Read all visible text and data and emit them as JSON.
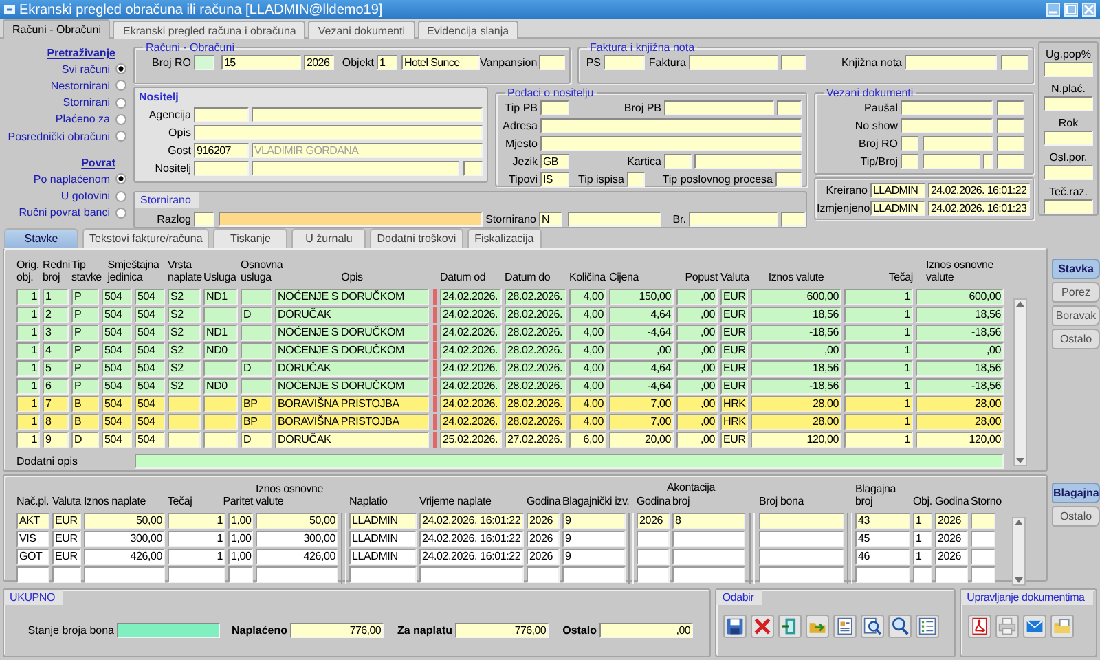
{
  "window": {
    "title": "Ekranski pregled obračuna ili računa [LLADMIN@lldemo19]"
  },
  "top_tabs": [
    {
      "label": "Računi - Obračuni",
      "selected": true
    },
    {
      "label": "Ekranski pregled računa i obračuna",
      "selected": false
    },
    {
      "label": "Vezani dokumenti",
      "selected": false
    },
    {
      "label": "Evidencija slanja",
      "selected": false
    }
  ],
  "search": {
    "heading": "Pretraživanje",
    "options": [
      {
        "label": "Svi računi",
        "selected": true
      },
      {
        "label": "Nestornirani",
        "selected": false
      },
      {
        "label": "Stornirani",
        "selected": false
      },
      {
        "label": "Plaćeno za",
        "selected": false
      },
      {
        "label": "Posrednički obračuni",
        "selected": false
      }
    ]
  },
  "refund": {
    "heading": "Povrat",
    "options": [
      {
        "label": "Po naplaćenom",
        "selected": true
      },
      {
        "label": "U gotovini",
        "selected": false
      },
      {
        "label": "Ručni povrat banci",
        "selected": false
      }
    ]
  },
  "invoice": {
    "title": "Računi - Obračuni",
    "broj_ro": {
      "label": "Broj RO",
      "number": "15",
      "year": "2026"
    },
    "objekt": {
      "label": "Objekt",
      "code": "1",
      "name": "Hotel Sunce"
    },
    "vanpansion": {
      "label": "Vanpansion"
    }
  },
  "invoice_notes": {
    "title": "Faktura i knjižna nota",
    "ps": {
      "label": "PS"
    },
    "faktura": {
      "label": "Faktura"
    },
    "knjizna_nota": {
      "label": "Knjižna nota"
    }
  },
  "holder": {
    "title": "Nositelj",
    "agencija": {
      "label": "Agencija"
    },
    "opis": {
      "label": "Opis"
    },
    "gost": {
      "label": "Gost",
      "code": "916207",
      "name": "VLADIMIR GORDANA",
      "name_disabled": true
    },
    "nositelj": {
      "label": "Nositelj"
    }
  },
  "holder_info": {
    "title": "Podaci o nositelju",
    "tip_pb": {
      "label": "Tip PB"
    },
    "broj_pb": {
      "label": "Broj PB"
    },
    "adresa": {
      "label": "Adresa"
    },
    "mjesto": {
      "label": "Mjesto"
    },
    "jezik": {
      "label": "Jezik",
      "code": "GB"
    },
    "kartica": {
      "label": "Kartica"
    },
    "tipovi": {
      "label": "Tipovi",
      "code": "IS"
    },
    "tip_ispisa": {
      "label": "Tip ispisa"
    },
    "tip_procesa": {
      "label": "Tip poslovnog procesa"
    }
  },
  "linked_docs": {
    "title": "Vezani dokumenti",
    "pausal": {
      "label": "Paušal"
    },
    "no_show": {
      "label": "No show"
    },
    "broj_ro": {
      "label": "Broj RO"
    },
    "tip_broj": {
      "label": "Tip/Broj"
    }
  },
  "audit": {
    "created": {
      "label": "Kreirano",
      "user": "LLADMIN",
      "time": "24.02.2026. 16:01:22"
    },
    "modified": {
      "label": "Izmjenjeno",
      "user": "LLADMIN",
      "time": "24.02.2026. 16:01:23"
    }
  },
  "storno": {
    "title": "Stornirano",
    "razlog": {
      "label": "Razlog"
    },
    "stornirano": {
      "label": "Stornirano",
      "code": "N"
    },
    "br": {
      "label": "Br."
    }
  },
  "side_fields": [
    {
      "label": "Ug.pop%"
    },
    {
      "label": "N.plać."
    },
    {
      "label": "Rok"
    },
    {
      "label": "Osl.por."
    },
    {
      "label": "Teč.raz."
    }
  ],
  "detail_tabs": [
    {
      "label": "Stavke",
      "selected": true
    },
    {
      "label": "Tekstovi fakture/računa",
      "selected": false
    },
    {
      "label": "Tiskanje",
      "selected": false
    },
    {
      "label": "U žurnalu",
      "selected": false
    },
    {
      "label": "Dodatni troškovi",
      "selected": false
    },
    {
      "label": "Fiskalizacija",
      "selected": false
    }
  ],
  "items": {
    "columns": [
      "Orig.\nobj.",
      "Redni\nbroj",
      "Tip\nstavke",
      "Smještajna\njedinica",
      "Vrsta\nnaplate",
      "Usluga",
      "Osnovna\nusluga",
      "Opis",
      "Datum od",
      "Datum do",
      "Količina",
      "Cijena",
      "Popust",
      "Valuta",
      "Iznos valute",
      "Tečaj",
      "Iznos osnovne\nvalute"
    ],
    "rows": [
      {
        "obj": "1",
        "no": "1",
        "type": "P",
        "unit": "504",
        "unit_2": "504",
        "charge": "S2",
        "service": "ND1",
        "description": "NOĆENJE S DORUČKOM",
        "from": "24.02.2026.",
        "to": "28.02.2026.",
        "qty": "4,00",
        "price": "150,00",
        "discount": ",00",
        "currency": "EUR",
        "amount": "600,00",
        "rate": "1",
        "base_amount": "600,00",
        "color": "#c8f7c5"
      },
      {
        "obj": "1",
        "no": "2",
        "type": "P",
        "unit": "504",
        "unit_2": "504",
        "charge": "S2",
        "base_service": "D",
        "description": "DORUČAK",
        "from": "24.02.2026.",
        "to": "28.02.2026.",
        "qty": "4,00",
        "price": "4,64",
        "discount": ",00",
        "currency": "EUR",
        "amount": "18,56",
        "rate": "1",
        "base_amount": "18,56",
        "color": "#c8f7c5"
      },
      {
        "obj": "1",
        "no": "3",
        "type": "P",
        "unit": "504",
        "unit_2": "504",
        "charge": "S2",
        "service": "ND1",
        "description": "NOĆENJE S DORUČKOM",
        "from": "24.02.2026.",
        "to": "28.02.2026.",
        "qty": "4,00",
        "price": "-4,64",
        "discount": ",00",
        "currency": "EUR",
        "amount": "-18,56",
        "rate": "1",
        "base_amount": "-18,56",
        "color": "#c8f7c5"
      },
      {
        "obj": "1",
        "no": "4",
        "type": "P",
        "unit": "504",
        "unit_2": "504",
        "charge": "S2",
        "service": "ND0",
        "description": "NOĆENJE S DORUČKOM",
        "from": "24.02.2026.",
        "to": "28.02.2026.",
        "qty": "4,00",
        "price": ",00",
        "discount": ",00",
        "currency": "EUR",
        "amount": ",00",
        "rate": "1",
        "base_amount": ",00",
        "color": "#c8f7c5"
      },
      {
        "obj": "1",
        "no": "5",
        "type": "P",
        "unit": "504",
        "unit_2": "504",
        "charge": "S2",
        "base_service": "D",
        "description": "DORUČAK",
        "from": "24.02.2026.",
        "to": "28.02.2026.",
        "qty": "4,00",
        "price": "4,64",
        "discount": ",00",
        "currency": "EUR",
        "amount": "18,56",
        "rate": "1",
        "base_amount": "18,56",
        "color": "#c8f7c5"
      },
      {
        "obj": "1",
        "no": "6",
        "type": "P",
        "unit": "504",
        "unit_2": "504",
        "charge": "S2",
        "service": "ND0",
        "description": "NOĆENJE S DORUČKOM",
        "from": "24.02.2026.",
        "to": "28.02.2026.",
        "qty": "4,00",
        "price": "-4,64",
        "discount": ",00",
        "currency": "EUR",
        "amount": "-18,56",
        "rate": "1",
        "base_amount": "-18,56",
        "color": "#c8f7c5"
      },
      {
        "obj": "1",
        "no": "7",
        "type": "B",
        "unit": "504",
        "unit_2": "504",
        "base_service": "BP",
        "description": "BORAVIŠNA PRISTOJBA",
        "from": "24.02.2026.",
        "to": "28.02.2026.",
        "qty": "4,00",
        "price": "7,00",
        "discount": ",00",
        "currency": "HRK",
        "amount": "28,00",
        "rate": "1",
        "base_amount": "28,00",
        "color": "#fff27a"
      },
      {
        "obj": "1",
        "no": "8",
        "type": "B",
        "unit": "504",
        "unit_2": "504",
        "base_service": "BP",
        "description": "BORAVIŠNA PRISTOJBA",
        "from": "24.02.2026.",
        "to": "28.02.2026.",
        "qty": "4,00",
        "price": "7,00",
        "discount": ",00",
        "currency": "HRK",
        "amount": "28,00",
        "rate": "1",
        "base_amount": "28,00",
        "color": "#fff27a"
      },
      {
        "obj": "1",
        "no": "9",
        "type": "D",
        "unit": "504",
        "unit_2": "504",
        "base_service": "D",
        "description": "DORUČAK",
        "from": "25.02.2026.",
        "to": "27.02.2026.",
        "qty": "6,00",
        "price": "20,00",
        "discount": ",00",
        "currency": "EUR",
        "amount": "120,00",
        "rate": "1",
        "base_amount": "120,00",
        "color": "#ffffc2"
      }
    ],
    "extra_label": "Dodatni opis"
  },
  "item_tabs": [
    {
      "label": "Stavka",
      "selected": true
    },
    {
      "label": "Porez",
      "selected": false
    },
    {
      "label": "Boravak",
      "selected": false
    },
    {
      "label": "Ostalo",
      "selected": false
    }
  ],
  "payments": {
    "columns": [
      "Nač.pl.",
      "Valuta",
      "Iznos naplate",
      "Tečaj",
      "Paritet",
      "Iznos osnovne\nvalute",
      "Naplatio",
      "Vrijeme naplate",
      "Godina",
      "Blagajnički izv.",
      "Godina",
      "broj",
      "Broj bona",
      "Blagajna\nbroj",
      "Obj.",
      "Godina",
      "Storno"
    ],
    "advance_heading": "Akontacija",
    "rows": [
      {
        "method": "AKT",
        "currency": "EUR",
        "amount": "50,00",
        "rate": "1",
        "parity": "1,00",
        "base_amount": "50,00",
        "collected_by": "LLADMIN",
        "time": "24.02.2026. 16:01:22",
        "year": "2026",
        "cash_report": "9",
        "advance_year": "2026",
        "advance_no": "8",
        "till_no": "43",
        "till_obj": "1",
        "till_year": "2026",
        "selected": true
      },
      {
        "method": "VIS",
        "currency": "EUR",
        "amount": "300,00",
        "rate": "1",
        "parity": "1,00",
        "base_amount": "300,00",
        "collected_by": "LLADMIN",
        "time": "24.02.2026. 16:01:22",
        "year": "2026",
        "cash_report": "9",
        "till_no": "45",
        "till_obj": "1",
        "till_year": "2026",
        "selected": false
      },
      {
        "method": "GOT",
        "currency": "EUR",
        "amount": "426,00",
        "rate": "1",
        "parity": "1,00",
        "base_amount": "426,00",
        "collected_by": "LLADMIN",
        "time": "24.02.2026. 16:01:22",
        "year": "2026",
        "cash_report": "9",
        "till_no": "46",
        "till_obj": "1",
        "till_year": "2026",
        "selected": false
      }
    ]
  },
  "payment_tabs": [
    {
      "label": "Blagajna",
      "selected": true
    },
    {
      "label": "Ostalo",
      "selected": false
    }
  ],
  "totals": {
    "title": "UKUPNO",
    "voucher_label": "Stanje broja bona",
    "paid": {
      "label": "Naplaćeno",
      "value": "776,00"
    },
    "due": {
      "label": "Za naplatu",
      "value": "776,00"
    },
    "other": {
      "label": "Ostalo",
      "value": ",00"
    }
  },
  "actions": {
    "title": "Odabir"
  },
  "documents": {
    "title": "Upravljanje dokumentima"
  }
}
